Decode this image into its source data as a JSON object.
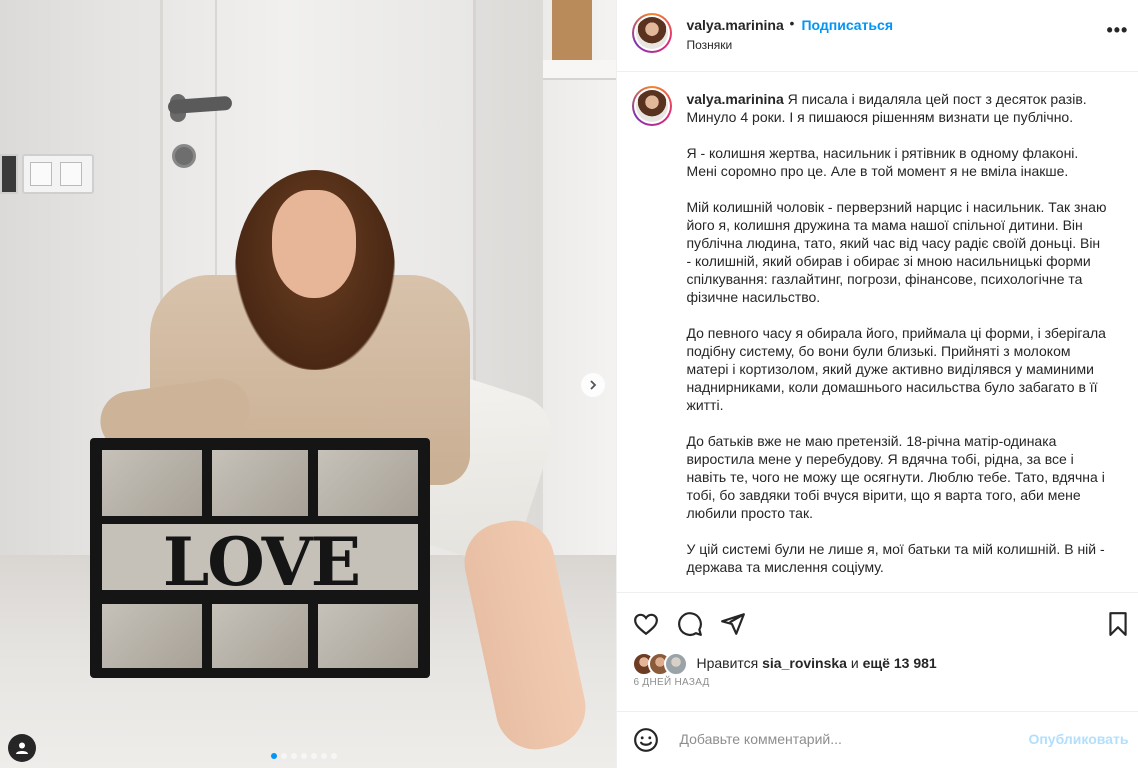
{
  "header": {
    "username": "valya.marinina",
    "bullet": "•",
    "follow_label": "Подписаться",
    "location": "Позняки",
    "more_label": "•••"
  },
  "media": {
    "frame_text": "LOVE",
    "next_icon": "chevron-right-icon",
    "slides_count": 7,
    "active_slide": 1
  },
  "caption": {
    "username": "valya.marinina",
    "paragraphs": [
      "Я писала і видаляла цей пост з десяток разів. Минуло 4 роки. І я пишаюся рішенням визнати це публічно.",
      "Я - колишня жертва, насильник і рятівник в одному флаконі. Мені соромно про це. Але в той момент я не вміла інакше.",
      "Мій колишній чоловік - перверзний нарцис і насильник. Так знаю його я, колишня дружина та мама нашої спільної дитини. Він публічна людина, тато, який час від часу радіє своїй доньці. Він - колишній, який обирав і обирає зі мною насильницькі форми спілкування: газлайтинг, погрози, фінансове, психологічне та фізичне насильство.",
      "До певного часу я обирала його, приймала ці форми, і зберігала подібну систему, бо вони були близькі. Прийняті з молоком матері і кортизолом, який дуже активно виділявся у маминими наднирниками, коли домашнього насильства було забагато в її житті.",
      "До батьків вже не маю претензій. 18-річна матір-одинака виростила мене у перебудову. Я вдячна тобі, рідна, за все і навіть те, чого не можу ще осягнути. Люблю тебе. Тато, вдячна і тобі, бо завдяки тобі вчуся вірити, що я варта того, аби мене любили просто так.",
      "У цій системі були не лише я, мої батьки та мій колишній. В ній - держава та мислення соціуму."
    ]
  },
  "actions": {
    "like_icon": "heart-icon",
    "comment_icon": "comment-icon",
    "share_icon": "share-icon",
    "save_icon": "bookmark-icon"
  },
  "likes": {
    "prefix": "Нравится",
    "user": "sia_rovinska",
    "connector": "и",
    "others": "ещё 13 981"
  },
  "date": "6 ДНЕЙ НАЗАД",
  "add_comment": {
    "placeholder": "Добавьте комментарий...",
    "post_label": "Опубликовать",
    "emoji_icon": "smile-icon"
  },
  "colors": {
    "accent": "#0095f6",
    "post_disabled": "#b2dffc",
    "muted": "#8e8e8e",
    "text": "#262626"
  }
}
